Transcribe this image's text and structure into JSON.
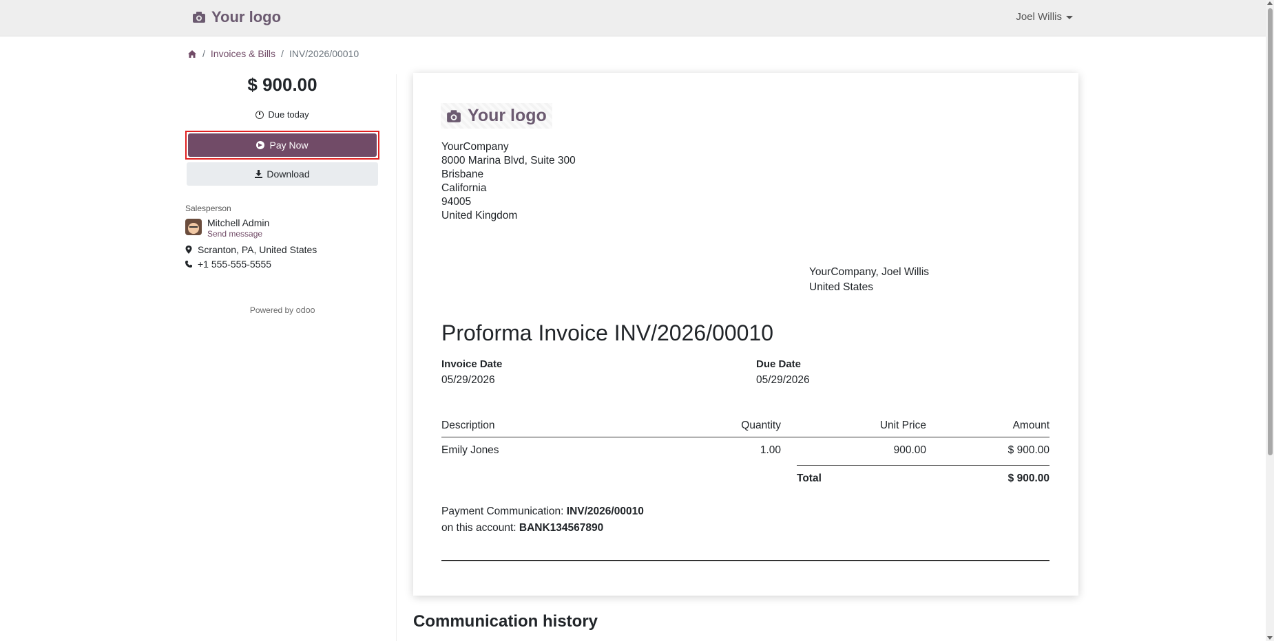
{
  "navbar": {
    "logo_text": "Your logo",
    "user_name": "Joel Willis"
  },
  "breadcrumb": {
    "home_icon": "home-icon",
    "items": [
      "Invoices & Bills",
      "INV/2026/00010"
    ]
  },
  "sidebar": {
    "amount": "$ 900.00",
    "due_text": "Due today",
    "pay_label": "Pay Now",
    "download_label": "Download",
    "salesperson_label": "Salesperson",
    "salesperson_name": "Mitchell Admin",
    "send_message": "Send message",
    "location": "Scranton, PA, United States",
    "phone": "+1 555-555-5555",
    "powered_by": "Powered by",
    "powered_brand": "odoo"
  },
  "invoice": {
    "logo_text": "Your logo",
    "company_lines": [
      "YourCompany",
      "8000 Marina Blvd, Suite 300",
      "Brisbane",
      "California",
      "94005",
      "United Kingdom"
    ],
    "customer_lines": [
      "YourCompany, Joel Willis",
      "United States"
    ],
    "title": "Proforma Invoice INV/2026/00010",
    "invoice_date_label": "Invoice Date",
    "invoice_date": "05/29/2026",
    "due_date_label": "Due Date",
    "due_date": "05/29/2026",
    "columns": {
      "description": "Description",
      "quantity": "Quantity",
      "unit_price": "Unit Price",
      "amount": "Amount"
    },
    "lines": [
      {
        "description": "Emily Jones",
        "quantity": "1.00",
        "unit_price": "900.00",
        "amount": "$ 900.00"
      }
    ],
    "total_label": "Total",
    "total_value": "$ 900.00",
    "payment_comm_label": "Payment Communication:",
    "payment_comm_value": "INV/2026/00010",
    "account_label": "on this account:",
    "account_value": "BANK134567890"
  },
  "communication_history_title": "Communication history",
  "colors": {
    "brand": "#714b67",
    "highlight_border": "#e02020"
  }
}
